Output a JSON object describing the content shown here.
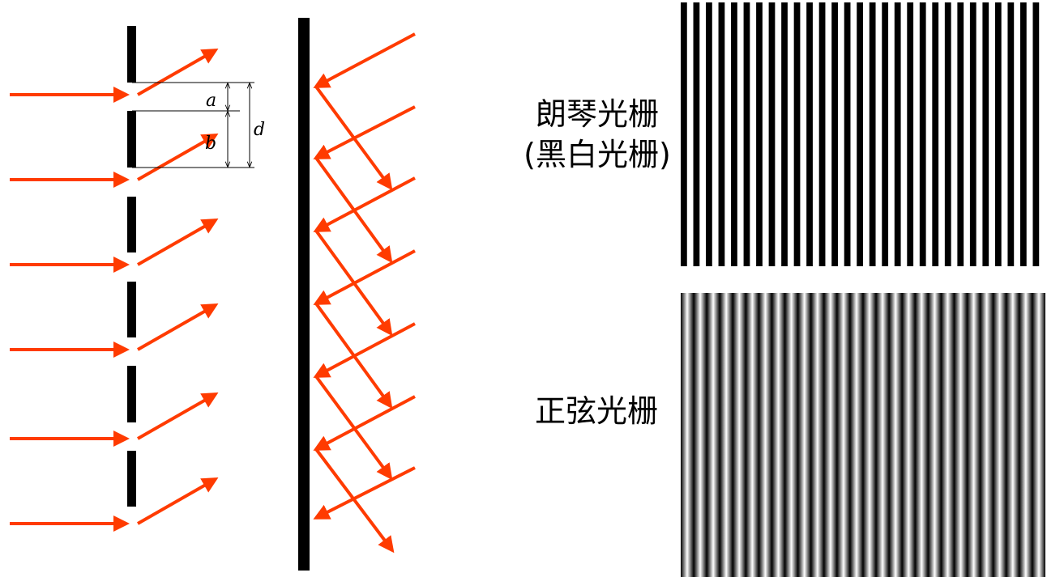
{
  "transmission_grating": {
    "labels": {
      "a": "a",
      "b": "b",
      "d": "d"
    },
    "arrow_color": "#ff3b00",
    "bar_color": "#000000"
  },
  "reflection_grating": {
    "arrow_color": "#ff3b00",
    "mirror_color": "#000000"
  },
  "ronchi_grating": {
    "label_line1": "朗琴光栅",
    "label_line2": "(黑白光栅)",
    "line_count": 29,
    "colors": [
      "#000000",
      "#ffffff"
    ]
  },
  "sine_grating": {
    "label": "正弦光栅",
    "period_count": 28,
    "colors": [
      "#000000",
      "#ffffff"
    ]
  }
}
